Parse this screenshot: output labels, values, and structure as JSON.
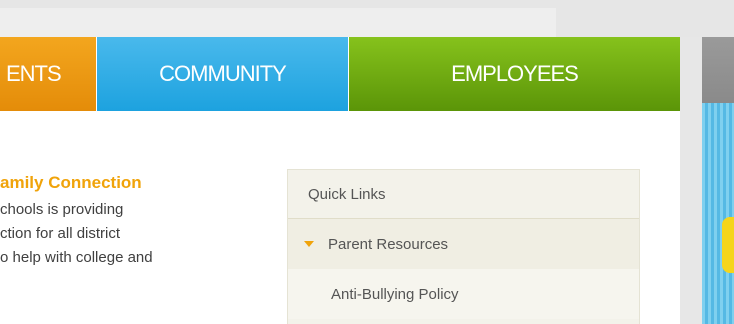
{
  "nav": {
    "items": [
      {
        "label": "ENTS"
      },
      {
        "label": "COMMUNITY"
      },
      {
        "label": "EMPLOYEES"
      }
    ]
  },
  "family_connection": {
    "title": "amily Connection",
    "lines": [
      "chools is providing",
      "ction for all district",
      "o help with college and"
    ]
  },
  "quick_links": {
    "header": "Quick Links",
    "parent_label": "Parent Resources",
    "child_label": "Anti-Bullying Policy"
  },
  "colors": {
    "students": "#e48c09",
    "community": "#1da2df",
    "employees": "#5b9508",
    "accent": "#f0a30a"
  }
}
